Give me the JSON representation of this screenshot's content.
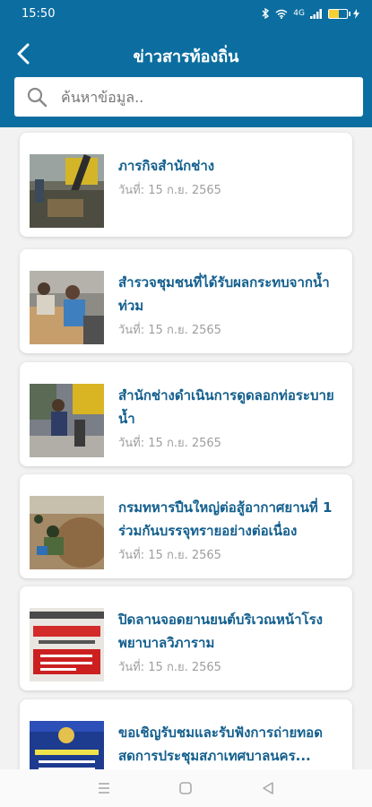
{
  "status_bar": {
    "time": "15:50",
    "signal_text": "4G"
  },
  "header": {
    "title": "ข่าวสารท้องถิ่น"
  },
  "search": {
    "placeholder": "ค้นหาข้อมูล.."
  },
  "news_items": [
    {
      "title_line1": "ภารกิจสำนักช่าง",
      "title_line2": "",
      "date": "วันที่: 15 ก.ย. 2565",
      "thumb": "construction-photo"
    },
    {
      "title_line1": "สำรวจชุมชนที่ได้รับผลกระทบจากน้ำ",
      "title_line2": "ท่วม",
      "date": "วันที่: 15 ก.ย. 2565",
      "thumb": "survey-photo"
    },
    {
      "title_line1": "สำนักช่างดำเนินการดูดลอกท่อระบาย",
      "title_line2": "น้ำ",
      "date": "วันที่: 15 ก.ย. 2565",
      "thumb": "drain-photo"
    },
    {
      "title_line1": "กรมทหารปืนใหญ่ต่อสู้อากาศยานที่ 1",
      "title_line2": "ร่วมกันบรรจุทรายอย่างต่อเนื่อง",
      "date": "วันที่: 15 ก.ย. 2565",
      "thumb": "sandbag-photo"
    },
    {
      "title_line1": "ปิดลานจอดยานยนต์บริเวณหน้าโรง",
      "title_line2": "พยาบาลวิภาราม",
      "date": "วันที่: 15 ก.ย. 2565",
      "thumb": "notice-sign"
    },
    {
      "title_line1": "ขอเชิญรับชมและรับฟังการถ่ายทอด",
      "title_line2": "สดการประชุมสภาเทศบาลนคร...",
      "date": "",
      "thumb": "meeting-poster"
    }
  ],
  "colors": {
    "header_bg": "#0c6ea0",
    "title_text": "#135f8e",
    "date_text": "#9e9e9e"
  }
}
